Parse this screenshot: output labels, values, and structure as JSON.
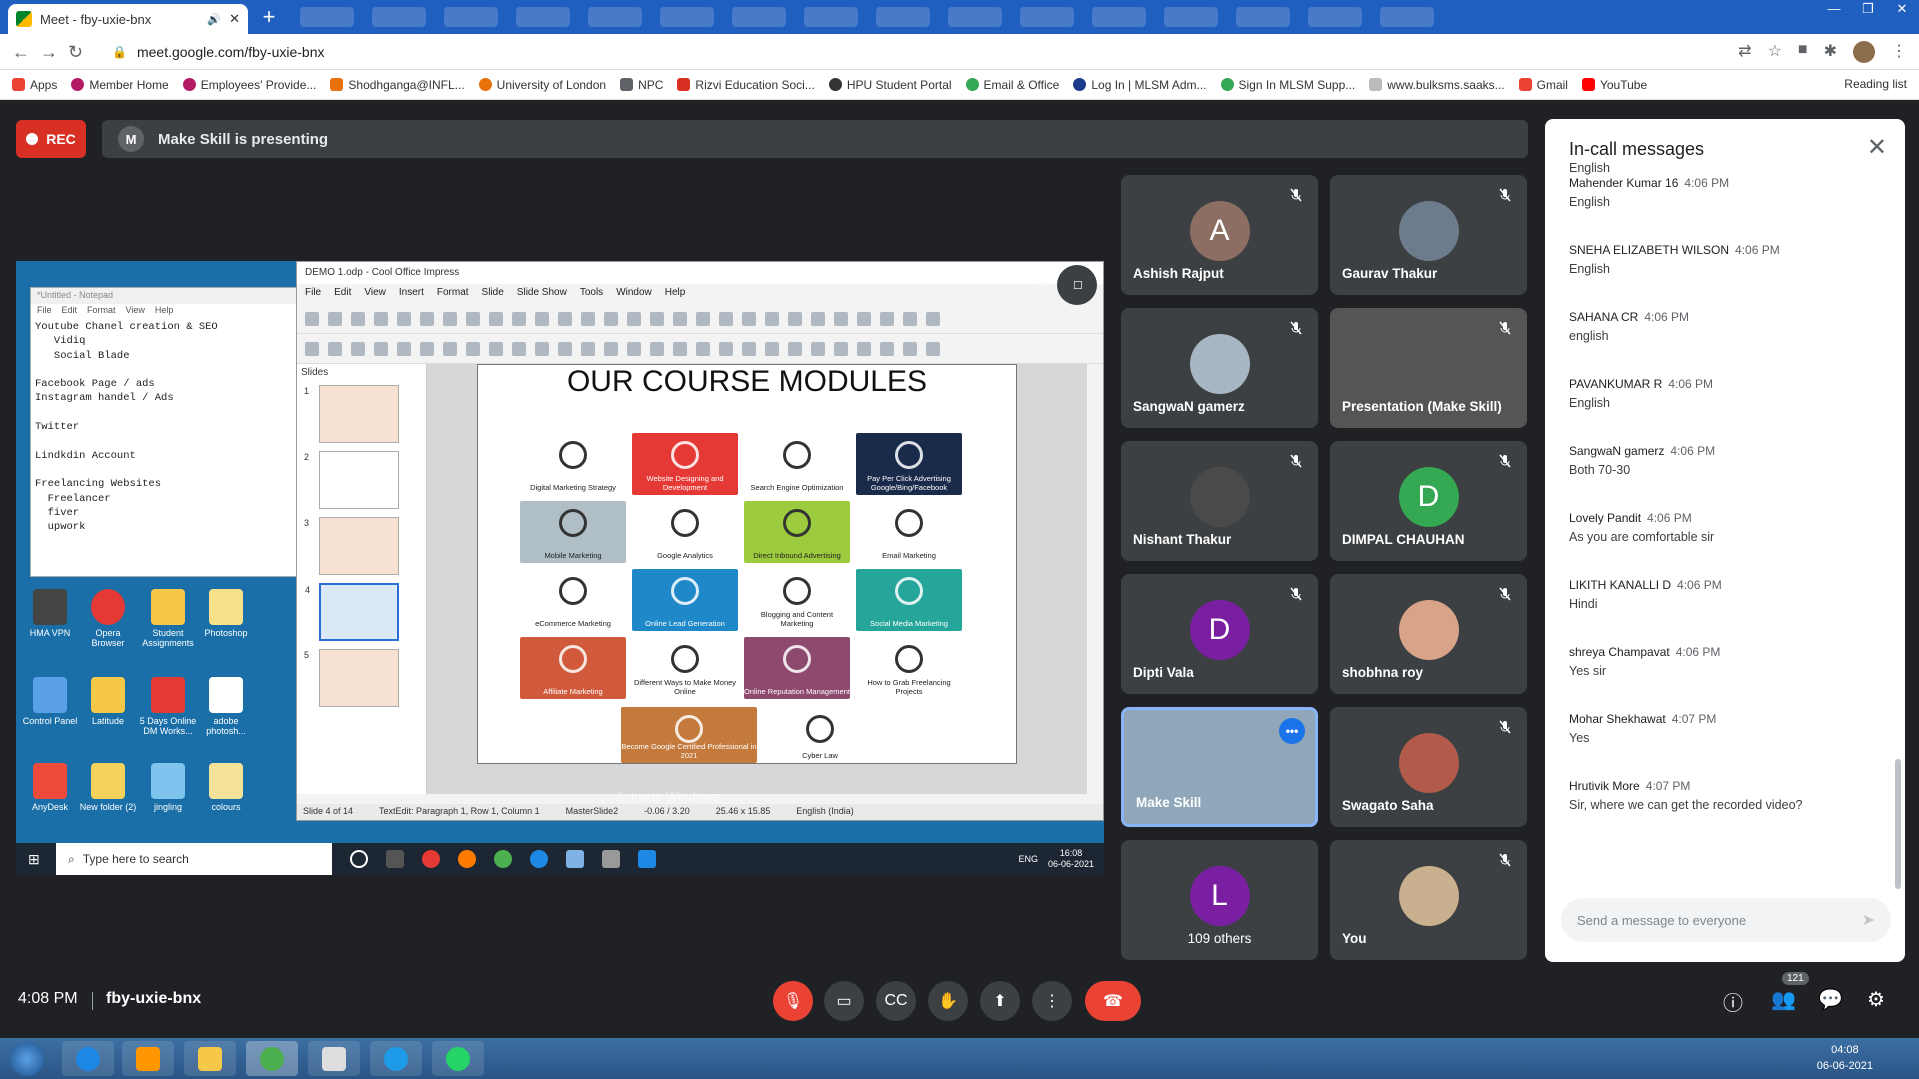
{
  "browser": {
    "tab_title": "Meet - fby-uxie-bnx",
    "url": "meet.google.com/fby-uxie-bnx",
    "bookmarks": [
      "Apps",
      "Member Home",
      "Employees' Provide...",
      "Shodhganga@INFL...",
      "University of London",
      "NPC",
      "Rizvi Education Soci...",
      "HPU Student Portal",
      "Email & Office",
      "Log In | MLSM Adm...",
      "Sign In MLSM Supp...",
      "www.bulksms.saaks...",
      "Gmail",
      "YouTube"
    ],
    "reading_list": "Reading list"
  },
  "meet": {
    "rec_label": "REC",
    "presenter_initial": "M",
    "presenting_text": "Make Skill is presenting",
    "time": "4:08 PM",
    "meeting_code": "fby-uxie-bnx",
    "participant_count": "121",
    "tiles": [
      {
        "name": "Ashish Rajput",
        "initial": "A",
        "color": "#8d6e63"
      },
      {
        "name": "Gaurav Thakur",
        "initial": "",
        "color": "#6d7c8c"
      },
      {
        "name": "SangwaN gamerz",
        "initial": "",
        "color": "#a8b6c4"
      },
      {
        "name": "Presentation (Make Skill)",
        "initial": "",
        "color": "#555"
      },
      {
        "name": "Nishant Thakur",
        "initial": "",
        "color": "#4a4a4a"
      },
      {
        "name": "DIMPAL CHAUHAN",
        "initial": "D",
        "color": "#34a853"
      },
      {
        "name": "Dipti Vala",
        "initial": "D",
        "color": "#7b1fa2"
      },
      {
        "name": "shobhna roy",
        "initial": "",
        "color": "#d9a38a"
      },
      {
        "name": "Make Skill",
        "initial": "",
        "color": "#8fa7b8"
      },
      {
        "name": "Swagato Saha",
        "initial": "",
        "color": "#b25b4b"
      },
      {
        "name": "109 others",
        "initial": "L",
        "color": "#7b1fa2"
      },
      {
        "name": "You",
        "initial": "",
        "color": "#c9b08f"
      }
    ]
  },
  "chat": {
    "title": "In-call messages",
    "partial_top": "English",
    "messages": [
      {
        "sender": "Mahender Kumar 16",
        "time": "4:06 PM",
        "text": "English"
      },
      {
        "sender": "SNEHA ELIZABETH WILSON",
        "time": "4:06 PM",
        "text": "English"
      },
      {
        "sender": "SAHANA CR",
        "time": "4:06 PM",
        "text": "english"
      },
      {
        "sender": "PAVANKUMAR R",
        "time": "4:06 PM",
        "text": "English"
      },
      {
        "sender": "SangwaN gamerz",
        "time": "4:06 PM",
        "text": "Both 70-30"
      },
      {
        "sender": "Lovely Pandit",
        "time": "4:06 PM",
        "text": "As you are comfortable sir"
      },
      {
        "sender": "LIKITH KANALLI D",
        "time": "4:06 PM",
        "text": "Hindi"
      },
      {
        "sender": "shreya Champavat",
        "time": "4:06 PM",
        "text": "Yes sir"
      },
      {
        "sender": "Mohar Shekhawat",
        "time": "4:07 PM",
        "text": "Yes"
      },
      {
        "sender": "Hrutivik More",
        "time": "4:07 PM",
        "text": "Sir, where we can get the recorded  video?"
      }
    ],
    "input_placeholder": "Send a message to everyone"
  },
  "shared": {
    "notepad_title": "*Untitled - Notepad",
    "notepad_menu": [
      "File",
      "Edit",
      "Format",
      "View",
      "Help"
    ],
    "notepad_text": "Youtube Chanel creation & SEO\n   Vidiq\n   Social Blade\n\nFacebook Page / ads\nInstagram handel / Ads\n\nTwitter\n\nLindkdin Account\n\nFreelancing Websites\n  Freelancer\n  fiver\n  upwork",
    "impress_title": "DEMO 1.odp - Cool Office Impress",
    "impress_menu": [
      "File",
      "Edit",
      "View",
      "Insert",
      "Format",
      "Slide",
      "Slide Show",
      "Tools",
      "Window",
      "Help"
    ],
    "slides_label": "Slides",
    "slide_title": "OUR COURSE MODULES",
    "modules": [
      {
        "label": "Digital Marketing Strategy",
        "color": "#ffffff"
      },
      {
        "label": "Website Designing and Development",
        "color": "#e53935"
      },
      {
        "label": "Search Engine Optimization",
        "color": "#ffffff"
      },
      {
        "label": "Pay Per Click Advertising Google/Bing/Facebook",
        "color": "#1a2a4a"
      },
      {
        "label": "Mobile Marketing",
        "color": "#b0bec5"
      },
      {
        "label": "Google Analytics",
        "color": "#ffffff"
      },
      {
        "label": "Direct Inbound Advertising",
        "color": "#9ccc3d"
      },
      {
        "label": "Email Marketing",
        "color": "#ffffff"
      },
      {
        "label": "eCommerce Marketing",
        "color": "#ffffff"
      },
      {
        "label": "Online Lead Generation",
        "color": "#1e88c8"
      },
      {
        "label": "Blogging and Content Marketing",
        "color": "#ffffff"
      },
      {
        "label": "Social Media Marketing",
        "color": "#26a69a"
      },
      {
        "label": "Affiliate Marketing",
        "color": "#d05a3b"
      },
      {
        "label": "Different Ways to Make Money Online",
        "color": "#ffffff"
      },
      {
        "label": "Online Reputation Management",
        "color": "#8e4a6e"
      },
      {
        "label": "How to Grab Freelancing Projects",
        "color": "#ffffff"
      },
      {
        "label": "Become Google Certified Professional in 2021",
        "color": "#c47a3c"
      },
      {
        "label": "Cyber Law",
        "color": "#ffffff"
      }
    ],
    "status": [
      "Slide 4 of 14",
      "TextEdit: Paragraph 1, Row 1, Column 1",
      "MasterSlide2",
      "-0.06 / 3.20",
      "25.46 x 15.85",
      "English (India)"
    ],
    "watermark": "Activate Windows",
    "desktop_icons": [
      "HMA VPN",
      "Opera Browser",
      "Student Assignments",
      "Photoshop",
      "Control Panel",
      "Latitude",
      "5 Days Online DM Works...",
      "adobe photosh...",
      "AnyDesk",
      "New folder (2)",
      "jingling",
      "colours"
    ],
    "taskbar_search": "Type here to search",
    "taskbar_lang": "ENG",
    "taskbar_time": "16:08",
    "taskbar_date": "06-06-2021"
  },
  "windows": {
    "time": "04:08",
    "date": "06-06-2021"
  }
}
